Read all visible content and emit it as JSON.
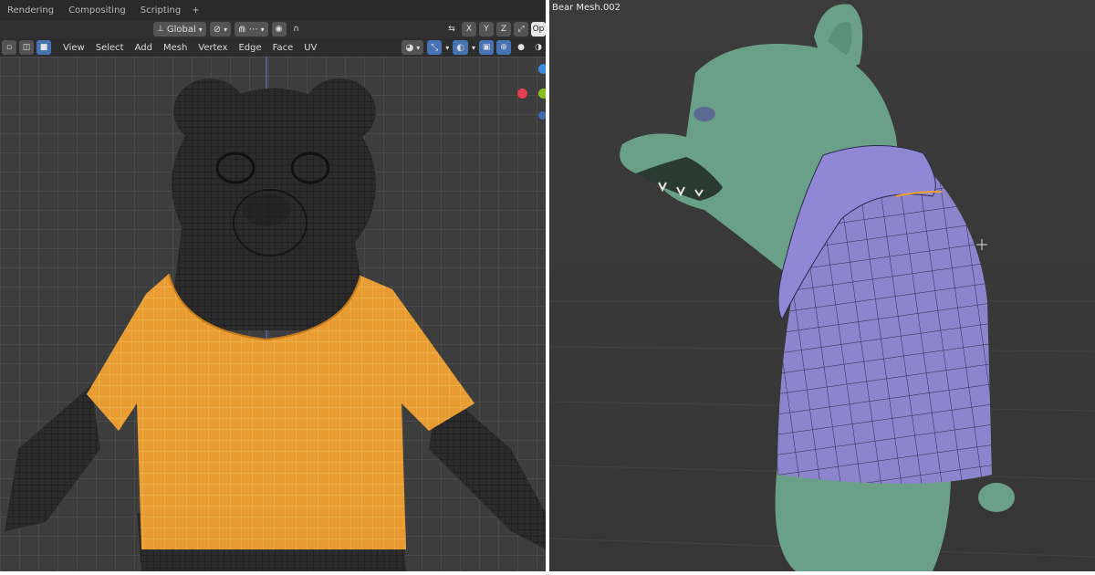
{
  "workspace_tabs": [
    "Rendering",
    "Compositing",
    "Scripting",
    "+"
  ],
  "header": {
    "orientation": "Global",
    "axes": [
      "X",
      "Y",
      "Z"
    ],
    "options_label": "Op"
  },
  "menu": [
    "View",
    "Select",
    "Add",
    "Mesh",
    "Vertex",
    "Edge",
    "Face",
    "UV"
  ],
  "right_view": {
    "object_name": "Bear Mesh.002"
  },
  "colors": {
    "selected_mesh": "#f0a030",
    "bear_skin": "#6aa088",
    "shirt": "#8c84cc",
    "gizmo_red": "#e04050",
    "gizmo_green": "#8ac020",
    "gizmo_blue": "#3a8ae0"
  },
  "icons": {
    "transform_pivot": "pivot-icon",
    "snapping": "magnet-icon",
    "proportional": "proportional-edit-icon",
    "overlays": "overlays-icon",
    "shading": "shading-sphere-icon"
  }
}
